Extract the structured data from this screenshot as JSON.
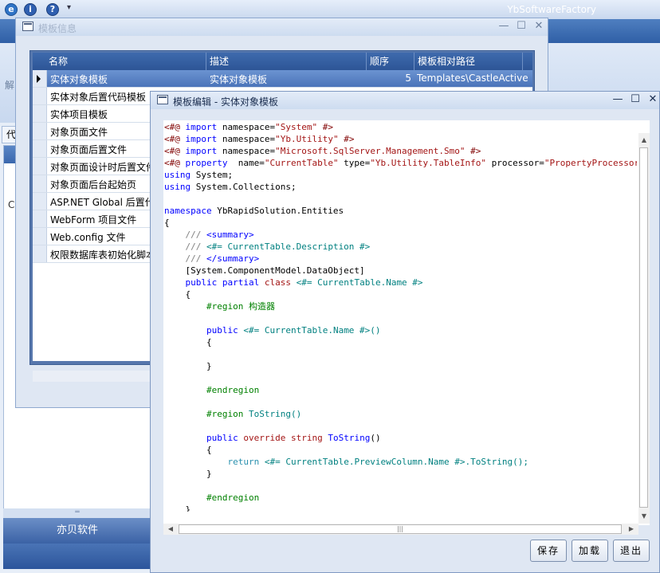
{
  "app": {
    "title": "YbSoftwareFactory",
    "ribbon_label": "解",
    "left_tab": "代",
    "left_char": "C",
    "company": "亦贝软件"
  },
  "template_info_window": {
    "title": "模板信息",
    "columns": [
      "名称",
      "描述",
      "顺序",
      "模板相对路径"
    ],
    "rows": [
      {
        "name": "实体对象模板",
        "description": "实体对象模板",
        "order": "5",
        "path": "Templates\\CastleActive",
        "selected": true
      },
      {
        "name": "实体对象后置代码模板"
      },
      {
        "name": "实体项目模板"
      },
      {
        "name": "对象页面文件"
      },
      {
        "name": "对象页面后置文件"
      },
      {
        "name": "对象页面设计时后置文件"
      },
      {
        "name": "对象页面后台起始页"
      },
      {
        "name": "ASP.NET Global 后置代"
      },
      {
        "name": "WebForm 项目文件"
      },
      {
        "name": "Web.config 文件"
      },
      {
        "name": "权限数据库表初始化脚本"
      }
    ]
  },
  "editor_window": {
    "title": "模板编辑 - 实体对象模板",
    "buttons": {
      "save": "保存",
      "add": "加载",
      "exit": "退出"
    }
  },
  "colors": {
    "ribbon": "#3a67ad",
    "selected_row": "#5a82c4",
    "keyword": "#0000ff",
    "template_text": "#008080"
  }
}
